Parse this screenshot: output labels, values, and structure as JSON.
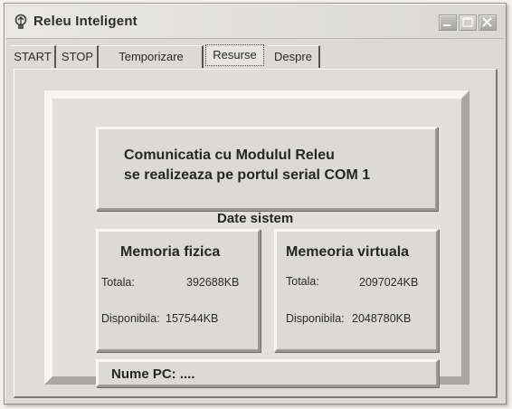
{
  "window": {
    "title": "Releu Inteligent"
  },
  "tabs": [
    {
      "label": "START"
    },
    {
      "label": "STOP"
    },
    {
      "label": "Temporizare"
    },
    {
      "label": "Resurse",
      "active": true
    },
    {
      "label": "Despre"
    }
  ],
  "resurse": {
    "comunicatie_line1": "Comunicatia cu Modulul Releu",
    "comunicatie_line2": "se realizeaza pe portul serial COM 1",
    "date_sistem_title": "Date sistem",
    "memoria_fizica": {
      "title": "Memoria fizica",
      "totala_label": "Totala:",
      "totala_value": "392688KB",
      "disponibila_label": "Disponibila:",
      "disponibila_value": "157544KB"
    },
    "memoria_virtuala": {
      "title": "Memeoria virtuala",
      "totala_label": "Totala:",
      "totala_value": "2097024KB",
      "disponibila_label": "Disponibila:",
      "disponibila_value": "2048780KB"
    },
    "nume_pc": "Nume PC: ...."
  },
  "icons": {
    "app": "relay-app-icon",
    "minimize": "minimize-icon",
    "maximize": "maximize-icon",
    "close": "close-icon"
  }
}
